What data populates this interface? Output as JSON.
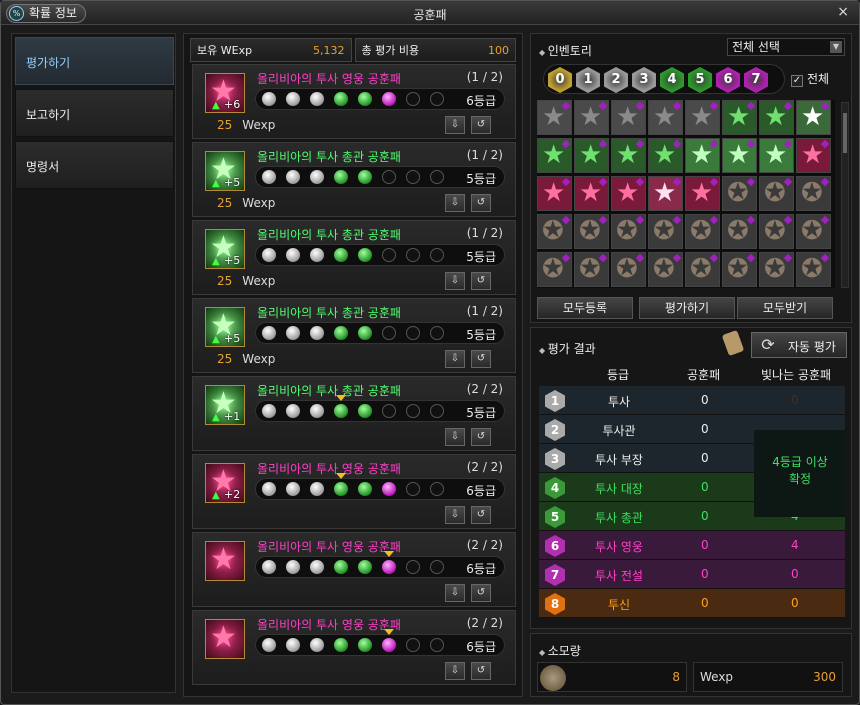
{
  "window": {
    "title": "공훈패",
    "prob_button": "확률 정보",
    "prob_icon": "%",
    "close": "×"
  },
  "sidebar": {
    "items": [
      {
        "label": "평가하기"
      },
      {
        "label": "보고하기"
      },
      {
        "label": "명령서"
      }
    ]
  },
  "stats": {
    "held_label": "보유 WExp",
    "held_value": "5,132",
    "cost_label": "총 평가 비용",
    "cost_value": "100"
  },
  "cards": [
    {
      "name": "올리비아의 투사 영웅 공훈패",
      "count": "(1 / 2)",
      "plus": "+6",
      "grade": "6등급",
      "wexp": "25",
      "unit": "Wexp",
      "color": "pink"
    },
    {
      "name": "올리비아의 투사 총관 공훈패",
      "count": "(1 / 2)",
      "plus": "+5",
      "grade": "5등급",
      "wexp": "25",
      "unit": "Wexp",
      "color": "green"
    },
    {
      "name": "올리비아의 투사 총관 공훈패",
      "count": "(1 / 2)",
      "plus": "+5",
      "grade": "5등급",
      "wexp": "25",
      "unit": "Wexp",
      "color": "green"
    },
    {
      "name": "올리비아의 투사 총관 공훈패",
      "count": "(1 / 2)",
      "plus": "+5",
      "grade": "5등급",
      "wexp": "25",
      "unit": "Wexp",
      "color": "green"
    },
    {
      "name": "올리비아의 투사 총관 공훈패",
      "count": "(2 / 2)",
      "plus": "+1",
      "grade": "5등급",
      "color": "green"
    },
    {
      "name": "올리비아의 투사 영웅 공훈패",
      "count": "(2 / 2)",
      "plus": "+2",
      "grade": "6등급",
      "color": "pink"
    },
    {
      "name": "올리비아의 투사 영웅 공훈패",
      "count": "(2 / 2)",
      "grade": "6등급",
      "color": "pink"
    },
    {
      "name": "올리비아의 투사 영웅 공훈패",
      "count": "(2 / 2)",
      "grade": "6등급",
      "color": "pink"
    }
  ],
  "inventory": {
    "title": "인벤토리",
    "select": "전체 선택",
    "grades": [
      "0",
      "1",
      "2",
      "3",
      "4",
      "5",
      "6",
      "7"
    ],
    "all_label": "전체",
    "check": "✓",
    "buttons": {
      "register_all": "모두등록",
      "evaluate": "평가하기",
      "receive_all": "모두받기"
    }
  },
  "result": {
    "title": "평가 결과",
    "auto": "자동 평가",
    "headers": {
      "grade": "등급",
      "medal": "공훈패",
      "shining": "빛나는 공훈패"
    },
    "rows": [
      {
        "num": "1",
        "name": "투사",
        "medal": "0",
        "shining": "0"
      },
      {
        "num": "2",
        "name": "투사관",
        "medal": "0",
        "shining": ""
      },
      {
        "num": "3",
        "name": "투사 부장",
        "medal": "0",
        "shining": "0"
      },
      {
        "num": "4",
        "name": "투사 대장",
        "medal": "0",
        "shining": "0"
      },
      {
        "num": "5",
        "name": "투사 총관",
        "medal": "0",
        "shining": "4"
      },
      {
        "num": "6",
        "name": "투사 영웅",
        "medal": "0",
        "shining": "4"
      },
      {
        "num": "7",
        "name": "투사 전설",
        "medal": "0",
        "shining": "0"
      },
      {
        "num": "8",
        "name": "투신",
        "medal": "0",
        "shining": "0"
      }
    ],
    "confirm_line1": "4등급 이상",
    "confirm_line2": "확정"
  },
  "cost": {
    "title": "소모량",
    "item_count": "8",
    "wexp_label": "Wexp",
    "wexp_value": "300"
  }
}
